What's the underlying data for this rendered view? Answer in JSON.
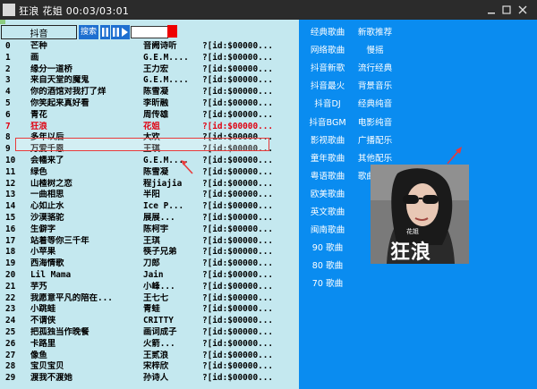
{
  "window": {
    "title": "狂浪  花姐  00:03/03:01"
  },
  "toolbar": {
    "search_value": "抖音",
    "search_label": "搜索"
  },
  "playback": {
    "progress": 0.017,
    "volume": 0.8
  },
  "songs": [
    {
      "n": "0",
      "title": "芒种",
      "artist": "音阙诗听",
      "id": "?[id:$00000..."
    },
    {
      "n": "1",
      "title": "画",
      "artist": "G.E.M....",
      "id": "?[id:$00000..."
    },
    {
      "n": "2",
      "title": "缘分一道桥",
      "artist": "王力宏",
      "id": "?[id:$00000..."
    },
    {
      "n": "3",
      "title": "来自天堂的魔鬼",
      "artist": "G.E.M....",
      "id": "?[id:$00000..."
    },
    {
      "n": "4",
      "title": "你的酒馆对我打了烊",
      "artist": "陈雪凝",
      "id": "?[id:$00000..."
    },
    {
      "n": "5",
      "title": "你笑起来真好看",
      "artist": "李昕融",
      "id": "?[id:$00000..."
    },
    {
      "n": "6",
      "title": "青花",
      "artist": "周传雄",
      "id": "?[id:$00000..."
    },
    {
      "n": "7",
      "title": "狂浪",
      "artist": "花姐",
      "id": "?[id:$00000..."
    },
    {
      "n": "8",
      "title": "多年以后",
      "artist": "大欢",
      "id": "?[id:$00000..."
    },
    {
      "n": "9",
      "title": "万爱千恩",
      "artist": "王琪",
      "id": "?[id:$00000..."
    },
    {
      "n": "10",
      "title": "会幡来了",
      "artist": "G.E.M....",
      "id": "?[id:$00000..."
    },
    {
      "n": "11",
      "title": "绿色",
      "artist": "陈雪凝",
      "id": "?[id:$00000..."
    },
    {
      "n": "12",
      "title": "山楂树之恋",
      "artist": "程jiajia",
      "id": "?[id:$00000..."
    },
    {
      "n": "13",
      "title": "一曲相思",
      "artist": "半阳",
      "id": "?[id:$00000..."
    },
    {
      "n": "14",
      "title": "心如止水",
      "artist": "Ice P...",
      "id": "?[id:$00000..."
    },
    {
      "n": "15",
      "title": "沙漠骆驼",
      "artist": "展展...",
      "id": "?[id:$00000..."
    },
    {
      "n": "16",
      "title": "生僻字",
      "artist": "陈柯宇",
      "id": "?[id:$00000..."
    },
    {
      "n": "17",
      "title": "站着等你三千年",
      "artist": "王琪",
      "id": "?[id:$00000..."
    },
    {
      "n": "18",
      "title": "小苹果",
      "artist": "筷子兄弟",
      "id": "?[id:$00000..."
    },
    {
      "n": "19",
      "title": "西海情歌",
      "artist": "刀郎",
      "id": "?[id:$00000..."
    },
    {
      "n": "20",
      "title": "Lil Mama",
      "artist": "Jain",
      "id": "?[id:$00000..."
    },
    {
      "n": "21",
      "title": "芋艿",
      "artist": "小峰...",
      "id": "?[id:$00000..."
    },
    {
      "n": "22",
      "title": "我愿意平凡的陪在...",
      "artist": "王七七",
      "id": "?[id:$00000..."
    },
    {
      "n": "23",
      "title": "小跳蛙",
      "artist": "青蛙",
      "id": "?[id:$00000..."
    },
    {
      "n": "24",
      "title": "不谓侠",
      "artist": "CRITTY",
      "id": "?[id:$00000..."
    },
    {
      "n": "25",
      "title": "把孤独当作晚餐",
      "artist": "画词成子",
      "id": "?[id:$00000..."
    },
    {
      "n": "26",
      "title": "卡路里",
      "artist": "火箭...",
      "id": "?[id:$00000..."
    },
    {
      "n": "27",
      "title": "像鱼",
      "artist": "王贰浪",
      "id": "?[id:$00000..."
    },
    {
      "n": "28",
      "title": "宝贝宝贝",
      "artist": "宋梓欣",
      "id": "?[id:$00000..."
    },
    {
      "n": "29",
      "title": "渡我不渡她",
      "artist": "孙诗人",
      "id": "?[id:$00000..."
    }
  ],
  "selected_index": 7,
  "categories_left": [
    "经典歌曲",
    "网络歌曲",
    "抖音新歌",
    "抖音最火",
    "抖音DJ",
    "抖音BGM",
    "影视歌曲",
    "童年歌曲",
    "粤语歌曲",
    "欧美歌曲",
    "英文歌曲",
    "闽南歌曲",
    "90 歌曲",
    "80 歌曲",
    "70 歌曲"
  ],
  "categories_right": [
    "新歌推荐",
    "慢摇",
    "流行经典",
    "背景音乐",
    "经典纯音",
    "电影纯音",
    "广播配乐",
    "其他配乐",
    "歌曲配音"
  ],
  "album": {
    "title_text": "狂浪",
    "artist_text": "花姐"
  },
  "colors": {
    "right_panel": "#0a8cf0",
    "list_bg": "#c4e8ef",
    "selected": "#e00010",
    "annotation": "#e83a3a"
  }
}
